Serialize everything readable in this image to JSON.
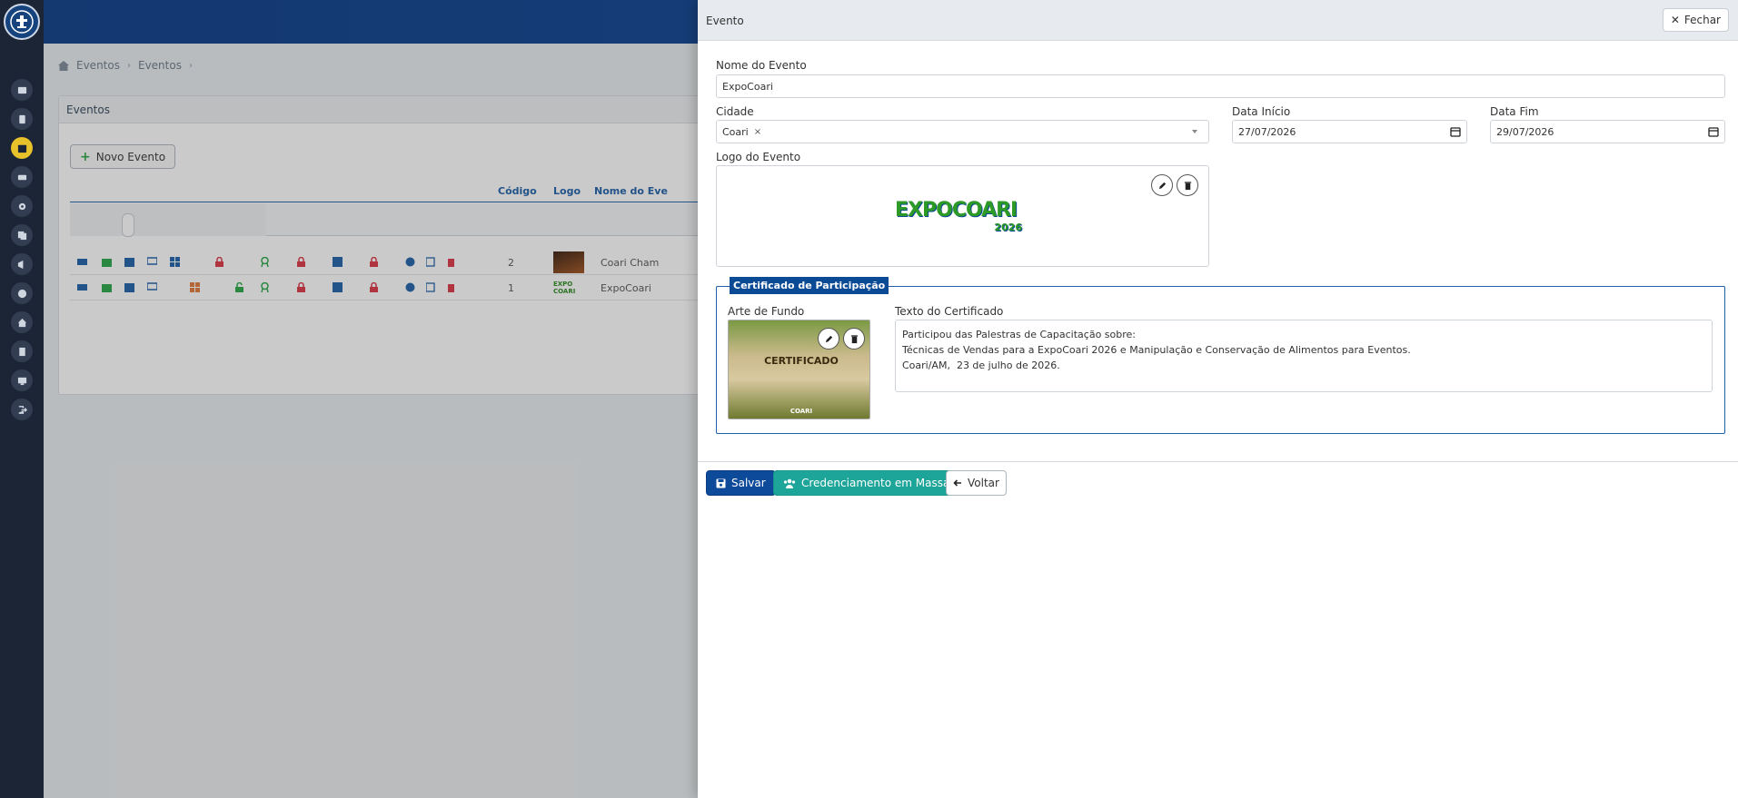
{
  "breadcrumb": {
    "items": [
      "Eventos",
      "Eventos"
    ]
  },
  "events_card": {
    "title": "Eventos",
    "new_button": "Novo Evento",
    "columns": [
      "Código",
      "Logo",
      "Nome do Eve"
    ],
    "rows": [
      {
        "code": "2",
        "name": "Coari Cham"
      },
      {
        "code": "1",
        "name": "ExpoCoari"
      }
    ]
  },
  "drawer": {
    "title": "Evento",
    "close_label": "Fechar",
    "event_name": {
      "label": "Nome do Evento",
      "value": "ExpoCoari"
    },
    "city": {
      "label": "Cidade",
      "value": "Coari",
      "remove": "×"
    },
    "start_date": {
      "label": "Data Início",
      "value": "27/07/2026"
    },
    "end_date": {
      "label": "Data Fim",
      "value": "29/07/2026"
    },
    "logo": {
      "label": "Logo do Evento",
      "text_main": "EXPOCOARI",
      "text_year": "2026"
    },
    "certificate": {
      "legend": "Certificado de Participação",
      "background_label": "Arte de Fundo",
      "text_label": "Texto do Certificado",
      "thumb_title": "CERTIFICADO",
      "thumb_footer": "COARI",
      "lines": [
        "Participou das Palestras de Capacitação sobre:",
        "Técnicas de Vendas para a ExpoCoari 2026 e Manipulação e Conservação de Alimentos para Eventos.",
        "Coari/AM,  23 de julho de 2026."
      ]
    },
    "buttons": {
      "save": "Salvar",
      "mass": "Credenciamento em Massa",
      "back": "Voltar"
    }
  },
  "colors": {
    "primary": "#0d4a9a",
    "teal": "#1ea59a",
    "sidebar": "#1c2536",
    "active_nav": "#e8c22b",
    "danger": "#dc3545",
    "success": "#28a745"
  }
}
